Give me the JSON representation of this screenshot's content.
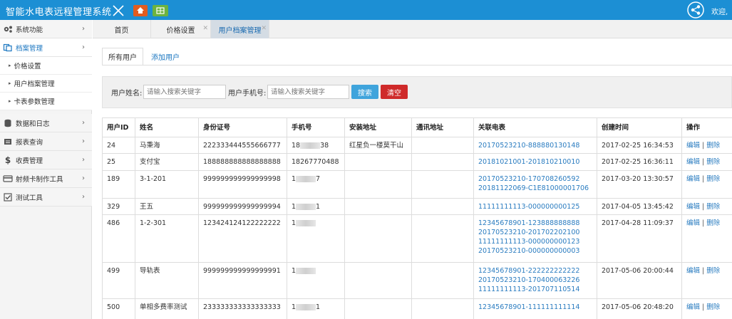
{
  "header": {
    "title": "智能水电表远程管理系统",
    "welcome": "欢迎,"
  },
  "sidebar": {
    "items": [
      {
        "label": "系统功能",
        "icon": "gears-icon"
      },
      {
        "label": "档案管理",
        "icon": "archive-icon",
        "active": true
      },
      {
        "label": "数据和日志",
        "icon": "database-icon"
      },
      {
        "label": "报表查询",
        "icon": "report-icon"
      },
      {
        "label": "收费管理",
        "icon": "dollar-icon"
      },
      {
        "label": "射频卡制作工具",
        "icon": "card-icon"
      },
      {
        "label": "测试工具",
        "icon": "checkbox-icon"
      }
    ],
    "subitems": [
      "价格设置",
      "用户档案管理",
      "卡表参数管理"
    ]
  },
  "tabs": [
    {
      "label": "首页"
    },
    {
      "label": "价格设置"
    },
    {
      "label": "用户档案管理",
      "active": true
    }
  ],
  "subtabs": [
    "所有用户",
    "添加用户"
  ],
  "search": {
    "name_label": "用户姓名:",
    "name_placeholder": "请输入搜索关键字",
    "phone_label": "用户手机号:",
    "phone_placeholder": "请输入搜索关键字",
    "search_button": "搜索",
    "clear_button": "清空"
  },
  "table": {
    "columns": [
      "用户ID",
      "姓名",
      "身份证号",
      "手机号",
      "安装地址",
      "通讯地址",
      "关联电表",
      "创建时间",
      "操作"
    ],
    "edit_label": "编辑",
    "delete_label": "删除",
    "rows": [
      {
        "id": "24",
        "name": "马秉海",
        "idcard": "222333444555666777",
        "phone_start": "18",
        "phone_end": "38",
        "install": "红星负一楼莫干山",
        "mail": "",
        "meters": [
          "20170523210-888880130148"
        ],
        "created": "2017-02-25 16:34:53"
      },
      {
        "id": "25",
        "name": "支付宝",
        "idcard": "188888888888888888",
        "phone_start": "18267770488",
        "phone_end": "",
        "install": "",
        "mail": "",
        "meters": [
          "20181021001-201810210010"
        ],
        "created": "2017-02-25 16:36:11"
      },
      {
        "id": "189",
        "name": "3-1-201",
        "idcard": "999999999999999998",
        "phone_start": "1",
        "phone_end": "7",
        "install": "",
        "mail": "",
        "meters": [
          "20170523210-170708260592",
          "20181122069-C1E81000001706"
        ],
        "created": "2017-03-20 13:30:57"
      },
      {
        "id": "329",
        "name": "王五",
        "idcard": "999999999999999994",
        "phone_start": "1",
        "phone_end": "1",
        "install": "",
        "mail": "",
        "meters": [
          "11111111113-000000000125"
        ],
        "created": "2017-04-05 13:45:42"
      },
      {
        "id": "486",
        "name": "1-2-301",
        "idcard": "123424124122222222",
        "phone_start": "1",
        "phone_end": "",
        "install": "",
        "mail": "",
        "meters": [
          "12345678901-123888888888",
          "20170523210-201702202100",
          "11111111113-000000000123",
          "20170523210-000000000003"
        ],
        "created": "2017-04-28 11:09:37"
      },
      {
        "id": "499",
        "name": "导轨表",
        "idcard": "999999999999999991",
        "phone_start": "1",
        "phone_end": "",
        "install": "",
        "mail": "",
        "meters": [
          "12345678901-222222222222",
          "20170523210-170400063226",
          "11111111113-201707110514"
        ],
        "created": "2017-05-06 20:00:44"
      },
      {
        "id": "500",
        "name": "单相多费率测试",
        "idcard": "233333333333333333",
        "phone_start": "1",
        "phone_end": "1",
        "install": "",
        "mail": "",
        "meters": [
          "12345678901-111111111114"
        ],
        "created": "2017-05-06 20:48:20"
      }
    ]
  }
}
